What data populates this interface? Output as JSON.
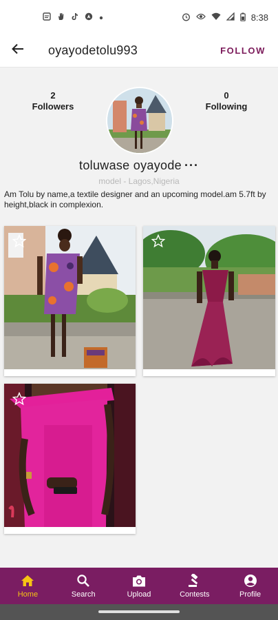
{
  "status_bar": {
    "time": "8:38",
    "left_icons": [
      "messages-icon",
      "hand-icon",
      "tiktok-icon",
      "app-icon",
      "dot-icon"
    ],
    "right_icons": [
      "alarm-icon",
      "eye-icon",
      "wifi-icon",
      "signal-icon",
      "battery-icon"
    ]
  },
  "header": {
    "username": "oyayodetolu993",
    "follow_label": "FOLLOW",
    "back_icon": "arrow-back-icon"
  },
  "profile": {
    "followers_count": "2",
    "followers_label": "Followers",
    "following_count": "0",
    "following_label": "Following",
    "display_name": "toluwase oyayode",
    "more_label": "···",
    "subtitle": "model - Lagos,Nigeria",
    "bio": "Am Tolu by name,a textile designer and an upcoming model.am 5.7ft by height,black in complexion."
  },
  "posts": [
    {
      "name": "post-1",
      "star_icon": "star-outline-icon"
    },
    {
      "name": "post-2",
      "star_icon": "star-outline-icon"
    },
    {
      "name": "post-3",
      "star_icon": "star-outline-icon"
    }
  ],
  "bottom_nav": {
    "items": [
      {
        "label": "Home",
        "icon": "home-icon",
        "active": true
      },
      {
        "label": "Search",
        "icon": "search-icon",
        "active": false
      },
      {
        "label": "Upload",
        "icon": "camera-icon",
        "active": false
      },
      {
        "label": "Contests",
        "icon": "gavel-icon",
        "active": false
      },
      {
        "label": "Profile",
        "icon": "profile-icon",
        "active": false
      }
    ]
  },
  "colors": {
    "brand": "#7a1d62",
    "active_nav": "#f6c414",
    "follow_text": "#7b1a5a",
    "background": "#f2f2f2"
  }
}
